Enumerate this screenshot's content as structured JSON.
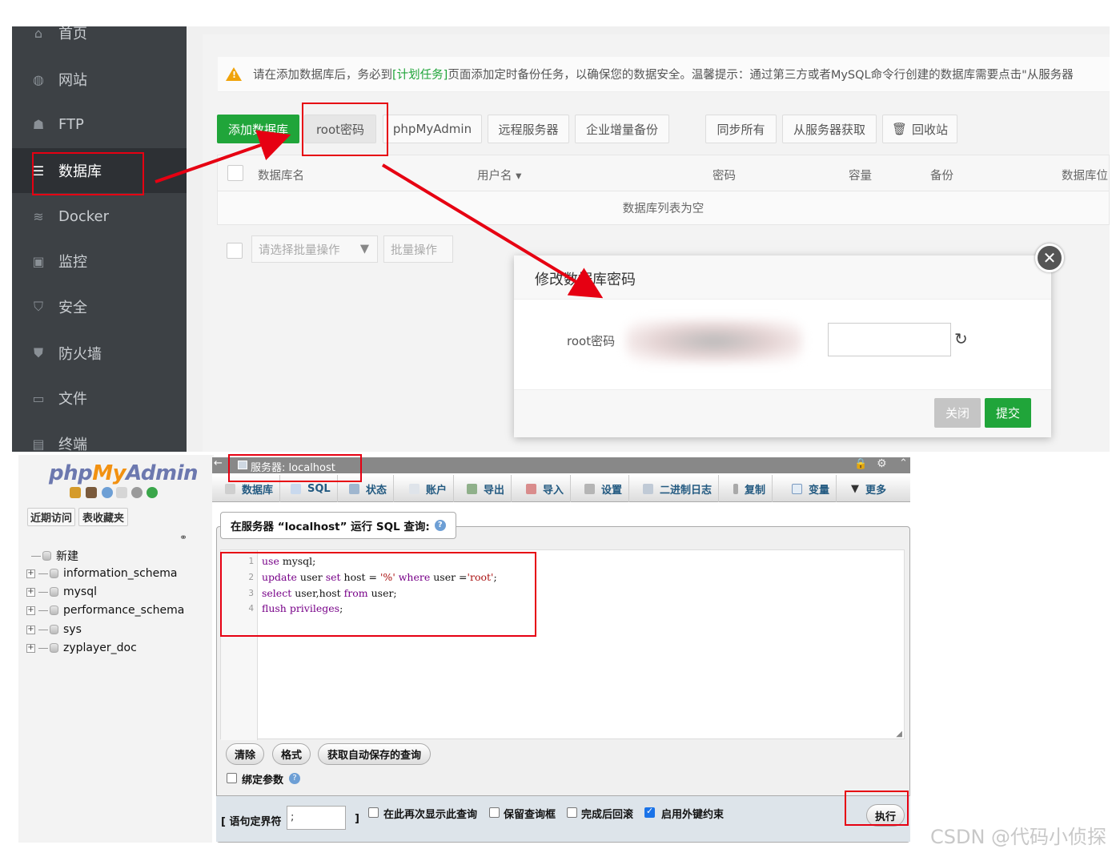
{
  "bt_panel": {
    "sidebar": {
      "items": [
        {
          "label": "首页",
          "icon": "home-icon"
        },
        {
          "label": "网站",
          "icon": "globe-icon"
        },
        {
          "label": "FTP",
          "icon": "user-icon"
        },
        {
          "label": "数据库",
          "icon": "database-icon",
          "active": true
        },
        {
          "label": "Docker",
          "icon": "docker-icon"
        },
        {
          "label": "监控",
          "icon": "monitor-icon"
        },
        {
          "label": "安全",
          "icon": "shield-check-icon"
        },
        {
          "label": "防火墙",
          "icon": "shield-icon"
        },
        {
          "label": "文件",
          "icon": "folder-icon"
        },
        {
          "label": "终端",
          "icon": "terminal-icon"
        }
      ]
    },
    "notice": {
      "prefix": "请在添加数据库后，务必到",
      "link": "[计划任务]",
      "suffix": "页面添加定时备份任务，以确保您的数据安全。温馨提示：通过第三方或者MySQL命令行创建的数据库需要点击\"从服务器"
    },
    "toolbar": {
      "add_db": "添加数据库",
      "root_password": "root密码",
      "phpmyadmin": "phpMyAdmin",
      "remote_server": "远程服务器",
      "enterprise_backup": "企业增量备份",
      "sync_all": "同步所有",
      "fetch_from_server": "从服务器获取",
      "recycle_bin": "回收站"
    },
    "table": {
      "columns": [
        "数据库名",
        "用户名",
        "密码",
        "容量",
        "备份",
        "数据库位"
      ],
      "empty_text": "数据库列表为空"
    },
    "batch": {
      "select_placeholder": "请选择批量操作",
      "batch_button": "批量操作"
    },
    "modal": {
      "title": "修改数据库密码",
      "field_label": "root密码",
      "close_label": "关闭",
      "submit_label": "提交"
    }
  },
  "phpmyadmin": {
    "logo": {
      "php": "php",
      "my": "My",
      "admin": "Admin"
    },
    "tabs": [
      "近期访问",
      "表收藏夹"
    ],
    "tree": {
      "new_label": "新建",
      "databases": [
        "information_schema",
        "mysql",
        "performance_schema",
        "sys",
        "zyplayer_doc"
      ]
    },
    "topbar_title": "服务器: localhost",
    "menu": [
      "数据库",
      "SQL",
      "状态",
      "账户",
      "导出",
      "导入",
      "设置",
      "二进制日志",
      "复制",
      "变量",
      "更多"
    ],
    "query_legend": "在服务器 “localhost” 运行 SQL 查询:",
    "editor": {
      "line_numbers": [
        "1",
        "2",
        "3",
        "4"
      ]
    },
    "buttons": {
      "clear": "清除",
      "format": "格式",
      "get_autosaved": "获取自动保存的查询",
      "execute": "执行"
    },
    "bind_params": "绑定参数",
    "footer": {
      "delimiter_label": "[ 语句定界符",
      "delimiter_value": ";",
      "bracket_close": "]",
      "options": [
        {
          "label": "在此再次显示此查询",
          "checked": false
        },
        {
          "label": "保留查询框",
          "checked": false
        },
        {
          "label": "完成后回滚",
          "checked": false
        },
        {
          "label": "启用外键约束",
          "checked": true
        }
      ]
    }
  },
  "watermark": "CSDN @代码小侦探",
  "colors": {
    "annotation_red": "#e60012",
    "bt_green": "#20a53a",
    "sidebar_bg": "#3d4145",
    "pma_blue": "#235a81"
  }
}
